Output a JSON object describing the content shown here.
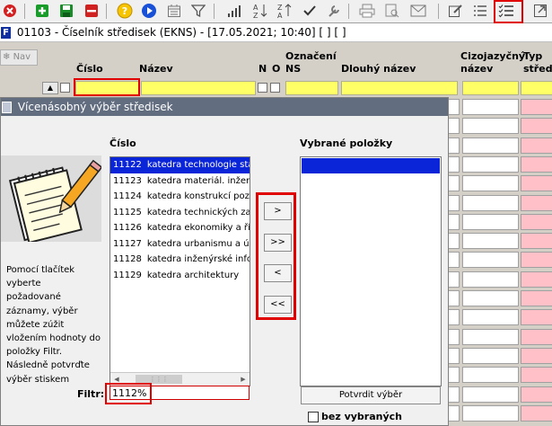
{
  "toolbar": {
    "icons": [
      "close-icon",
      "add-icon",
      "save-icon",
      "delete-icon",
      "help-icon",
      "run-icon",
      "calendar-icon",
      "filter-icon",
      "chart-icon",
      "sort-az-icon",
      "sort-za-icon",
      "check-icon",
      "wrench-icon",
      "print-icon",
      "print-preview-icon",
      "mail-icon",
      "edit-icon",
      "list-icon",
      "checklist-icon",
      "export-icon"
    ],
    "help_glyph": "?"
  },
  "window": {
    "app_badge": "F",
    "title": "01103 - Číselník středisek (EKNS) - [17.05.2021; 10:40]  [ ]  [ ]"
  },
  "grid": {
    "nav_label": "Nav",
    "headers": {
      "cislo": "Číslo",
      "nazev": "Název",
      "n": "N",
      "o": "O",
      "oznaceni_line1": "Označení",
      "oznaceni_line2": "NS",
      "dlouhy_nazev": "Dlouhý název",
      "cizojazycny_line1": "Cizojazyčný",
      "cizojazycny_line2": "název",
      "typ_line1": "Typ",
      "typ_line2": "středi"
    }
  },
  "dialog": {
    "title": "Vícenásobný výběr středisek",
    "cislo_header": "Číslo",
    "selected_header": "Vybrané položky",
    "items": [
      {
        "code": "11122",
        "name": "katedra technologie stav"
      },
      {
        "code": "11123",
        "name": "katedra materiál. inženýr"
      },
      {
        "code": "11124",
        "name": "katedra konstrukcí pozer"
      },
      {
        "code": "11125",
        "name": "katedra technických zař"
      },
      {
        "code": "11126",
        "name": "katedra ekonomiky a říze"
      },
      {
        "code": "11127",
        "name": "katedra urbanismu a úze"
      },
      {
        "code": "11128",
        "name": "katedra inženýrské infor"
      },
      {
        "code": "11129",
        "name": "katedra architektury"
      }
    ],
    "buttons": {
      "move_one": ">",
      "move_all": ">>",
      "remove_one": "<",
      "remove_all": "<<"
    },
    "help_text": [
      "Pomocí tlačítek",
      "vyberte",
      "požadované",
      "záznamy, výběr",
      "můžete zúžit",
      "vložením hodnoty do",
      "položky Filtr.",
      "Následně potvrďte",
      "výběr stiskem"
    ],
    "filter_label": "Filtr:",
    "filter_value": "1112%",
    "confirm_button": "Potvrdit výběr",
    "without_selected_label": "bez vybraných"
  },
  "colors": {
    "accent_red": "#e00000",
    "selection_blue": "#0a24d8",
    "dialog_title_bg": "#626d80",
    "highlight_yellow": "#ffff66",
    "pink_cell": "#ffc0c8"
  }
}
